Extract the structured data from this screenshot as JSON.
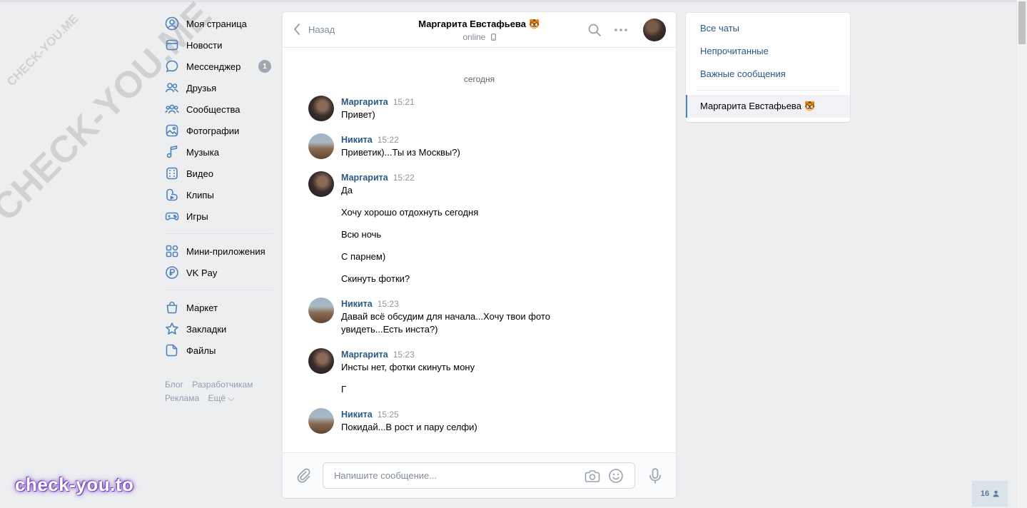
{
  "watermark": {
    "small": "CHECK-YOU.ME",
    "large": "CHECK-YOU.ME",
    "brand": "check-you.to"
  },
  "leftnav": {
    "items": [
      {
        "label": "Моя страница",
        "icon": "user-circle-icon"
      },
      {
        "label": "Новости",
        "icon": "newspaper-icon"
      },
      {
        "label": "Мессенджер",
        "icon": "chat-bubble-icon",
        "badge": "1"
      },
      {
        "label": "Друзья",
        "icon": "friends-icon"
      },
      {
        "label": "Сообщества",
        "icon": "communities-icon"
      },
      {
        "label": "Фотографии",
        "icon": "photo-icon"
      },
      {
        "label": "Музыка",
        "icon": "music-icon"
      },
      {
        "label": "Видео",
        "icon": "video-icon"
      },
      {
        "label": "Клипы",
        "icon": "clips-icon"
      },
      {
        "label": "Игры",
        "icon": "gamepad-icon"
      }
    ],
    "group2": [
      {
        "label": "Мини-приложения",
        "icon": "apps-grid-icon"
      },
      {
        "label": "VK Pay",
        "icon": "vkpay-icon"
      }
    ],
    "group3": [
      {
        "label": "Маркет",
        "icon": "shopping-bag-icon"
      },
      {
        "label": "Закладки",
        "icon": "star-icon"
      },
      {
        "label": "Файлы",
        "icon": "file-icon"
      }
    ],
    "footer": {
      "blog": "Блог",
      "developers": "Разработчикам",
      "ads": "Реклама",
      "more": "Ещё ⌵"
    }
  },
  "chat": {
    "back_label": "Назад",
    "peer_name": "Маргарита Евстафьева 🐯",
    "peer_status": "online",
    "day_label": "сегодня",
    "messages": [
      {
        "author": "Маргарита",
        "time": "15:21",
        "lines": [
          "Привет)"
        ]
      },
      {
        "author": "Никита",
        "time": "15:22",
        "lines": [
          "Приветик)...Ты из Москвы?)"
        ]
      },
      {
        "author": "Маргарита",
        "time": "15:22",
        "lines": [
          "Да",
          "Хочу хорошо отдохнуть сегодня",
          "Всю ночь",
          "С парнем)",
          "Скинуть фотки?"
        ]
      },
      {
        "author": "Никита",
        "time": "15:23",
        "lines": [
          "Давай всё обсудим для начала...Хочу твои фото увидеть...Есть инста?)"
        ]
      },
      {
        "author": "Маргарита",
        "time": "15:23",
        "lines": [
          "Инсты нет, фотки скинуть мону",
          "Г"
        ]
      },
      {
        "author": "Никита",
        "time": "15:25",
        "lines": [
          "Покидай...В рост и пару селфи)"
        ]
      }
    ],
    "composer": {
      "placeholder": "Напишите сообщение...",
      "value": ""
    }
  },
  "rpanel": {
    "folders": [
      "Все чаты",
      "Непрочитанные",
      "Важные сообщения"
    ],
    "active_conversation": "Маргарита Евстафьева 🐯"
  },
  "online_counter": "16",
  "colors": {
    "link": "#2a5885",
    "accent": "#5181b8",
    "background": "#edeef0",
    "muted": "#818c99"
  }
}
